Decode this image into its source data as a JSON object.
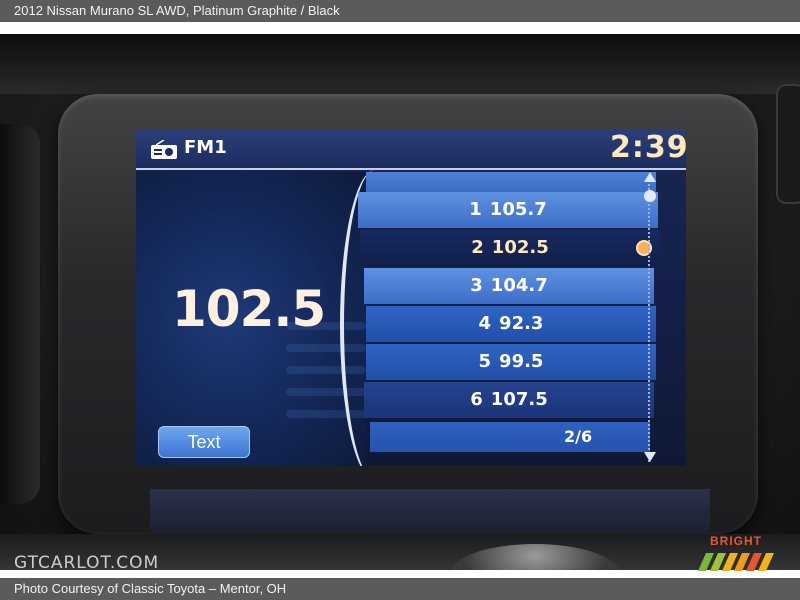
{
  "caption": {
    "title": "2012 Nissan Murano SL AWD,  Platinum Graphite / Black",
    "credit": "Photo Courtesy of Classic Toyota – Mentor, OH"
  },
  "watermark": "GTCARLOT.COM",
  "dash": {
    "bright_label": "BRIGHT"
  },
  "screen": {
    "band": "FM1",
    "clock": "2:39",
    "current_frequency": "102.5",
    "text_button": "Text",
    "page_indicator": "2/6",
    "presets": [
      {
        "number": "1",
        "frequency": "105.7",
        "selected": false
      },
      {
        "number": "2",
        "frequency": "102.5",
        "selected": true
      },
      {
        "number": "3",
        "frequency": "104.7",
        "selected": false
      },
      {
        "number": "4",
        "frequency": "92.3",
        "selected": false
      },
      {
        "number": "5",
        "frequency": "99.5",
        "selected": false
      },
      {
        "number": "6",
        "frequency": "107.5",
        "selected": false
      }
    ],
    "icons": {
      "band_icon": "radio-icon",
      "selected_icon": "check-icon"
    },
    "colors": {
      "accent_text": "#ffe9b8",
      "button": "#3a74d2"
    }
  }
}
